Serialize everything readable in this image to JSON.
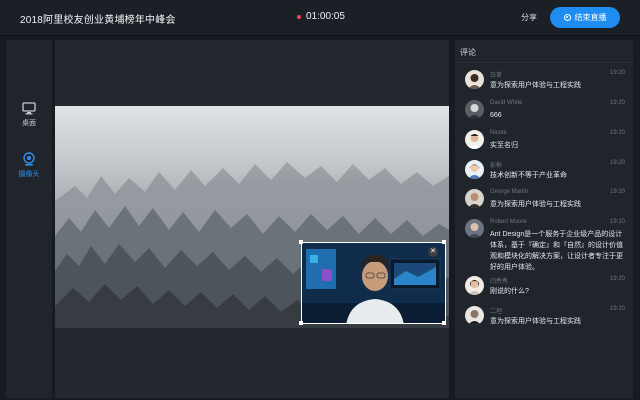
{
  "header": {
    "title": "2018阿里校友创业黄埔榜年中峰会",
    "timer": "01:00:05",
    "share_label": "分享",
    "end_label": "结束直播"
  },
  "sidebar": {
    "items": [
      {
        "label": "桌面",
        "icon": "monitor-icon",
        "active": false
      },
      {
        "label": "摄像头",
        "icon": "webcam-icon",
        "active": true
      }
    ]
  },
  "comments": {
    "title": "评论",
    "items": [
      {
        "name": "白草",
        "time": "19:20",
        "text": "意为探索用户体验与工程实践"
      },
      {
        "name": "David White",
        "time": "19:20",
        "text": "666"
      },
      {
        "name": "Nicole",
        "time": "19:20",
        "text": "实至名归"
      },
      {
        "name": "彭彬",
        "time": "19:20",
        "text": "技术创新不等于产业革命"
      },
      {
        "name": "George Martin",
        "time": "19:20",
        "text": "意为探索用户体验与工程实践"
      },
      {
        "name": "Robert Moore",
        "time": "19:20",
        "text": "Ant Design是一个服务于企业级产品的设计体系，基于『确定』和『自然』的设计价值观和模块化的解决方案，让设计者专注于更好的用户体验。"
      },
      {
        "name": "闫秀秀",
        "time": "19:20",
        "text": "刚说的什么?"
      },
      {
        "name": "二坦",
        "time": "19:20",
        "text": "意为探索用户体验与工程实践"
      }
    ]
  },
  "colors": {
    "accent": "#1f8cf0",
    "recording": "#f04a4a",
    "background": "#161b22",
    "panel": "#20252c"
  }
}
